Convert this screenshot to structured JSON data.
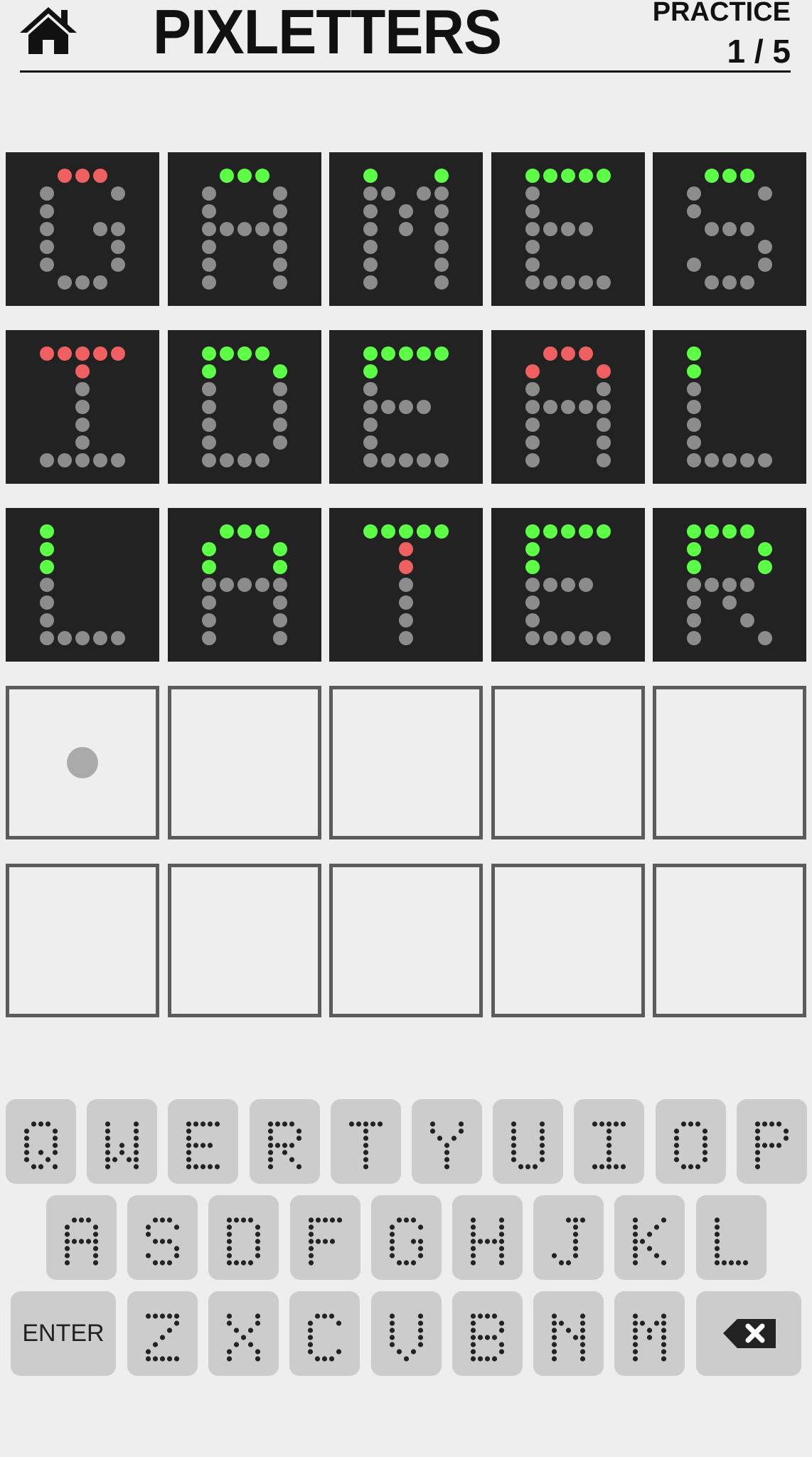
{
  "header": {
    "title": "PIXLETTERS",
    "mode": "PRACTICE",
    "progress": "1 / 5",
    "home_icon": "home-icon"
  },
  "colors": {
    "correct": "#5cff45",
    "present": "#f06060",
    "absent": "#8c8c8c",
    "tile_bg": "#222222",
    "page_bg": "#eeeeee",
    "key_bg": "#cccccc"
  },
  "board": {
    "rows": [
      {
        "word": "GAMES",
        "tiles": [
          {
            "letter": "G",
            "segments": [
              "present",
              "absent",
              "absent",
              "absent"
            ]
          },
          {
            "letter": "A",
            "segments": [
              "correct",
              "absent",
              "absent",
              "absent"
            ]
          },
          {
            "letter": "M",
            "segments": [
              "correct",
              "absent",
              "absent",
              "absent"
            ]
          },
          {
            "letter": "E",
            "segments": [
              "correct",
              "absent",
              "absent",
              "absent"
            ]
          },
          {
            "letter": "S",
            "segments": [
              "correct",
              "absent",
              "absent",
              "absent"
            ]
          }
        ]
      },
      {
        "word": "IDEAL",
        "tiles": [
          {
            "letter": "I",
            "segments": [
              "present",
              "present",
              "absent",
              "absent"
            ]
          },
          {
            "letter": "D",
            "segments": [
              "correct",
              "correct",
              "absent",
              "absent"
            ]
          },
          {
            "letter": "E",
            "segments": [
              "correct",
              "correct",
              "absent",
              "absent"
            ]
          },
          {
            "letter": "A",
            "segments": [
              "present",
              "present",
              "absent",
              "absent"
            ]
          },
          {
            "letter": "L",
            "segments": [
              "correct",
              "correct",
              "absent",
              "absent"
            ]
          }
        ]
      },
      {
        "word": "LATER",
        "tiles": [
          {
            "letter": "L",
            "segments": [
              "correct",
              "correct",
              "correct",
              "absent"
            ]
          },
          {
            "letter": "A",
            "segments": [
              "correct",
              "correct",
              "correct",
              "absent"
            ]
          },
          {
            "letter": "T",
            "segments": [
              "correct",
              "present",
              "present",
              "absent"
            ]
          },
          {
            "letter": "E",
            "segments": [
              "correct",
              "correct",
              "correct",
              "absent"
            ]
          },
          {
            "letter": "R",
            "segments": [
              "correct",
              "correct",
              "correct",
              "absent"
            ]
          }
        ]
      },
      {
        "word": "",
        "tiles": [
          {
            "letter": "",
            "cursor": true
          },
          {
            "letter": ""
          },
          {
            "letter": ""
          },
          {
            "letter": ""
          },
          {
            "letter": ""
          }
        ]
      },
      {
        "word": "",
        "tiles": [
          {
            "letter": ""
          },
          {
            "letter": ""
          },
          {
            "letter": ""
          },
          {
            "letter": ""
          },
          {
            "letter": ""
          }
        ]
      }
    ]
  },
  "keyboard": {
    "rows": [
      [
        "Q",
        "W",
        "E",
        "R",
        "T",
        "Y",
        "U",
        "I",
        "O",
        "P"
      ],
      [
        "A",
        "S",
        "D",
        "F",
        "G",
        "H",
        "J",
        "K",
        "L"
      ],
      [
        "ENTER",
        "Z",
        "X",
        "C",
        "V",
        "B",
        "N",
        "M",
        "BACKSPACE"
      ]
    ],
    "enter_label": "ENTER",
    "backspace_icon": "backspace-icon"
  }
}
